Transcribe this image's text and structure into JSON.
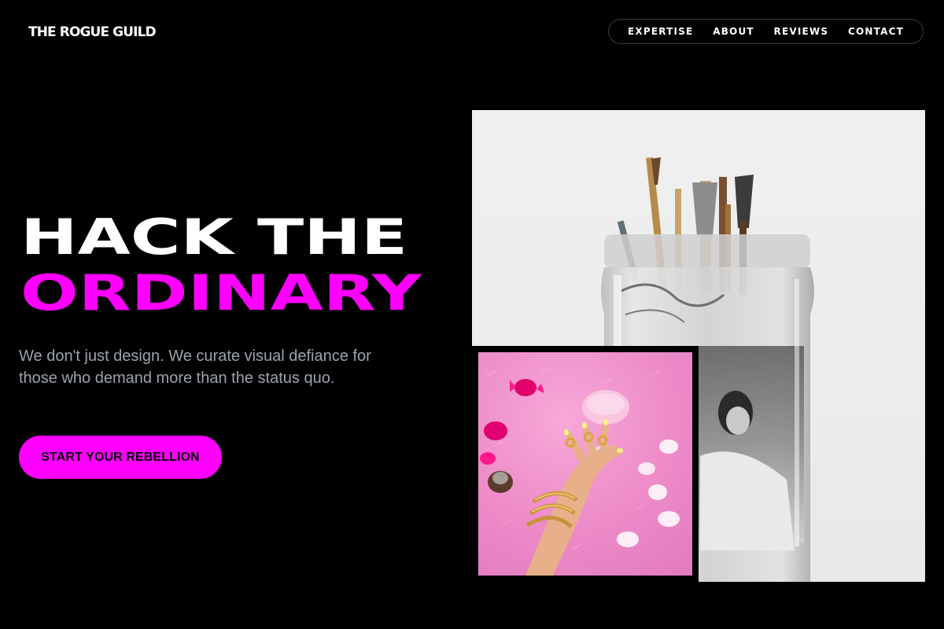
{
  "header": {
    "logo_text": "THE ROGUE GUILD",
    "nav": [
      {
        "label": "EXPERTISE"
      },
      {
        "label": "ABOUT"
      },
      {
        "label": "REVIEWS"
      },
      {
        "label": "CONTACT"
      }
    ]
  },
  "hero": {
    "title_line1": "HACK THE",
    "title_line2": "ORDINARY",
    "subtitle": "We don't just design. We curate visual defiance for those who demand more than the status quo.",
    "cta_label": "START YOUR REBELLION"
  },
  "images": {
    "large_photo": "paintbrushes-in-glass-jar",
    "small_photo": "hand-with-gold-jewelry-and-pink-drink"
  },
  "colors": {
    "background": "#000000",
    "accent": "#ff00ff",
    "text_primary": "#ffffff",
    "text_muted": "#9ca3af"
  }
}
